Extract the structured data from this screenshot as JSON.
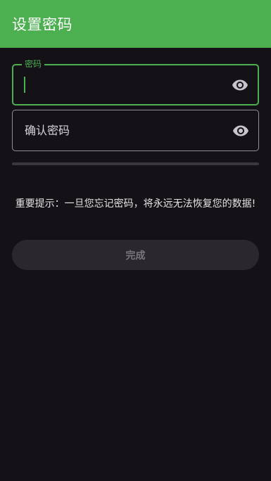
{
  "app_bar": {
    "title": "设置密码"
  },
  "password_field": {
    "label": "密码",
    "value": "",
    "toggle_icon": "eye-icon"
  },
  "confirm_field": {
    "placeholder": "确认密码",
    "value": "",
    "toggle_icon": "eye-icon"
  },
  "strength": {
    "level": 0
  },
  "warning": "重要提示：一旦您忘记密码，将永远无法恢复您的数据!",
  "done_button": {
    "label": "完成",
    "enabled": false
  },
  "colors": {
    "accent": "#4caf50",
    "background": "#151217",
    "outline": "#938f99",
    "disabled_button": "#2a272d"
  }
}
